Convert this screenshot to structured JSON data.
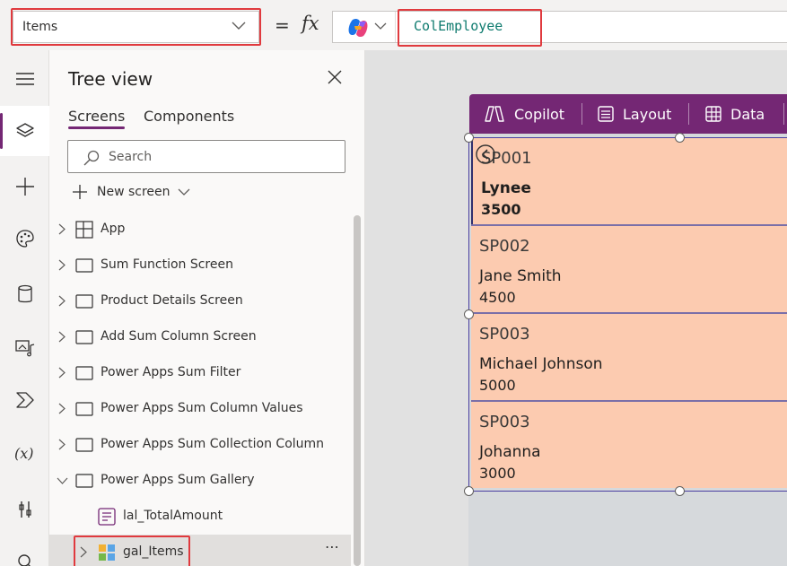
{
  "formula_bar": {
    "property": "Items",
    "equals": "=",
    "fx": "fx",
    "formula": "ColEmployee"
  },
  "tree_view": {
    "title": "Tree view",
    "tabs": [
      {
        "label": "Screens",
        "active": true
      },
      {
        "label": "Components",
        "active": false
      }
    ],
    "search_placeholder": "Search",
    "new_screen_label": "New screen",
    "items": [
      {
        "label": "App",
        "icon": "app-icon",
        "level": 0,
        "expanded": false
      },
      {
        "label": "Sum Function Screen",
        "icon": "screen-icon",
        "level": 0,
        "expanded": false
      },
      {
        "label": "Product Details Screen",
        "icon": "screen-icon",
        "level": 0,
        "expanded": false
      },
      {
        "label": "Add Sum Column Screen",
        "icon": "screen-icon",
        "level": 0,
        "expanded": false
      },
      {
        "label": "Power Apps Sum Filter",
        "icon": "screen-icon",
        "level": 0,
        "expanded": false
      },
      {
        "label": "Power Apps Sum Column Values",
        "icon": "screen-icon",
        "level": 0,
        "expanded": false
      },
      {
        "label": "Power Apps Sum Collection Column",
        "icon": "screen-icon",
        "level": 0,
        "expanded": false
      },
      {
        "label": "Power Apps Sum Gallery",
        "icon": "screen-icon",
        "level": 0,
        "expanded": true
      },
      {
        "label": "lal_TotalAmount",
        "icon": "label-icon",
        "level": 1
      },
      {
        "label": "gal_Items",
        "icon": "gallery-icon",
        "level": 1,
        "expanded": false,
        "selected": true,
        "more": "⋯"
      }
    ]
  },
  "canvas_toolbar": {
    "copilot": "Copilot",
    "layout": "Layout",
    "data": "Data"
  },
  "gallery": {
    "items": [
      {
        "id": "SP001",
        "name": "Lynee",
        "amount": "3500"
      },
      {
        "id": "SP002",
        "name": "Jane Smith",
        "amount": "4500"
      },
      {
        "id": "SP003",
        "name": "Michael Johnson",
        "amount": "5000"
      },
      {
        "id": "SP003",
        "name": "Johanna",
        "amount": "3000"
      }
    ]
  },
  "colors": {
    "accent": "#742774",
    "gallery_item_bg": "#fccbb0",
    "highlight_box": "#e03a3e",
    "formula_text": "#0f7b6f"
  }
}
